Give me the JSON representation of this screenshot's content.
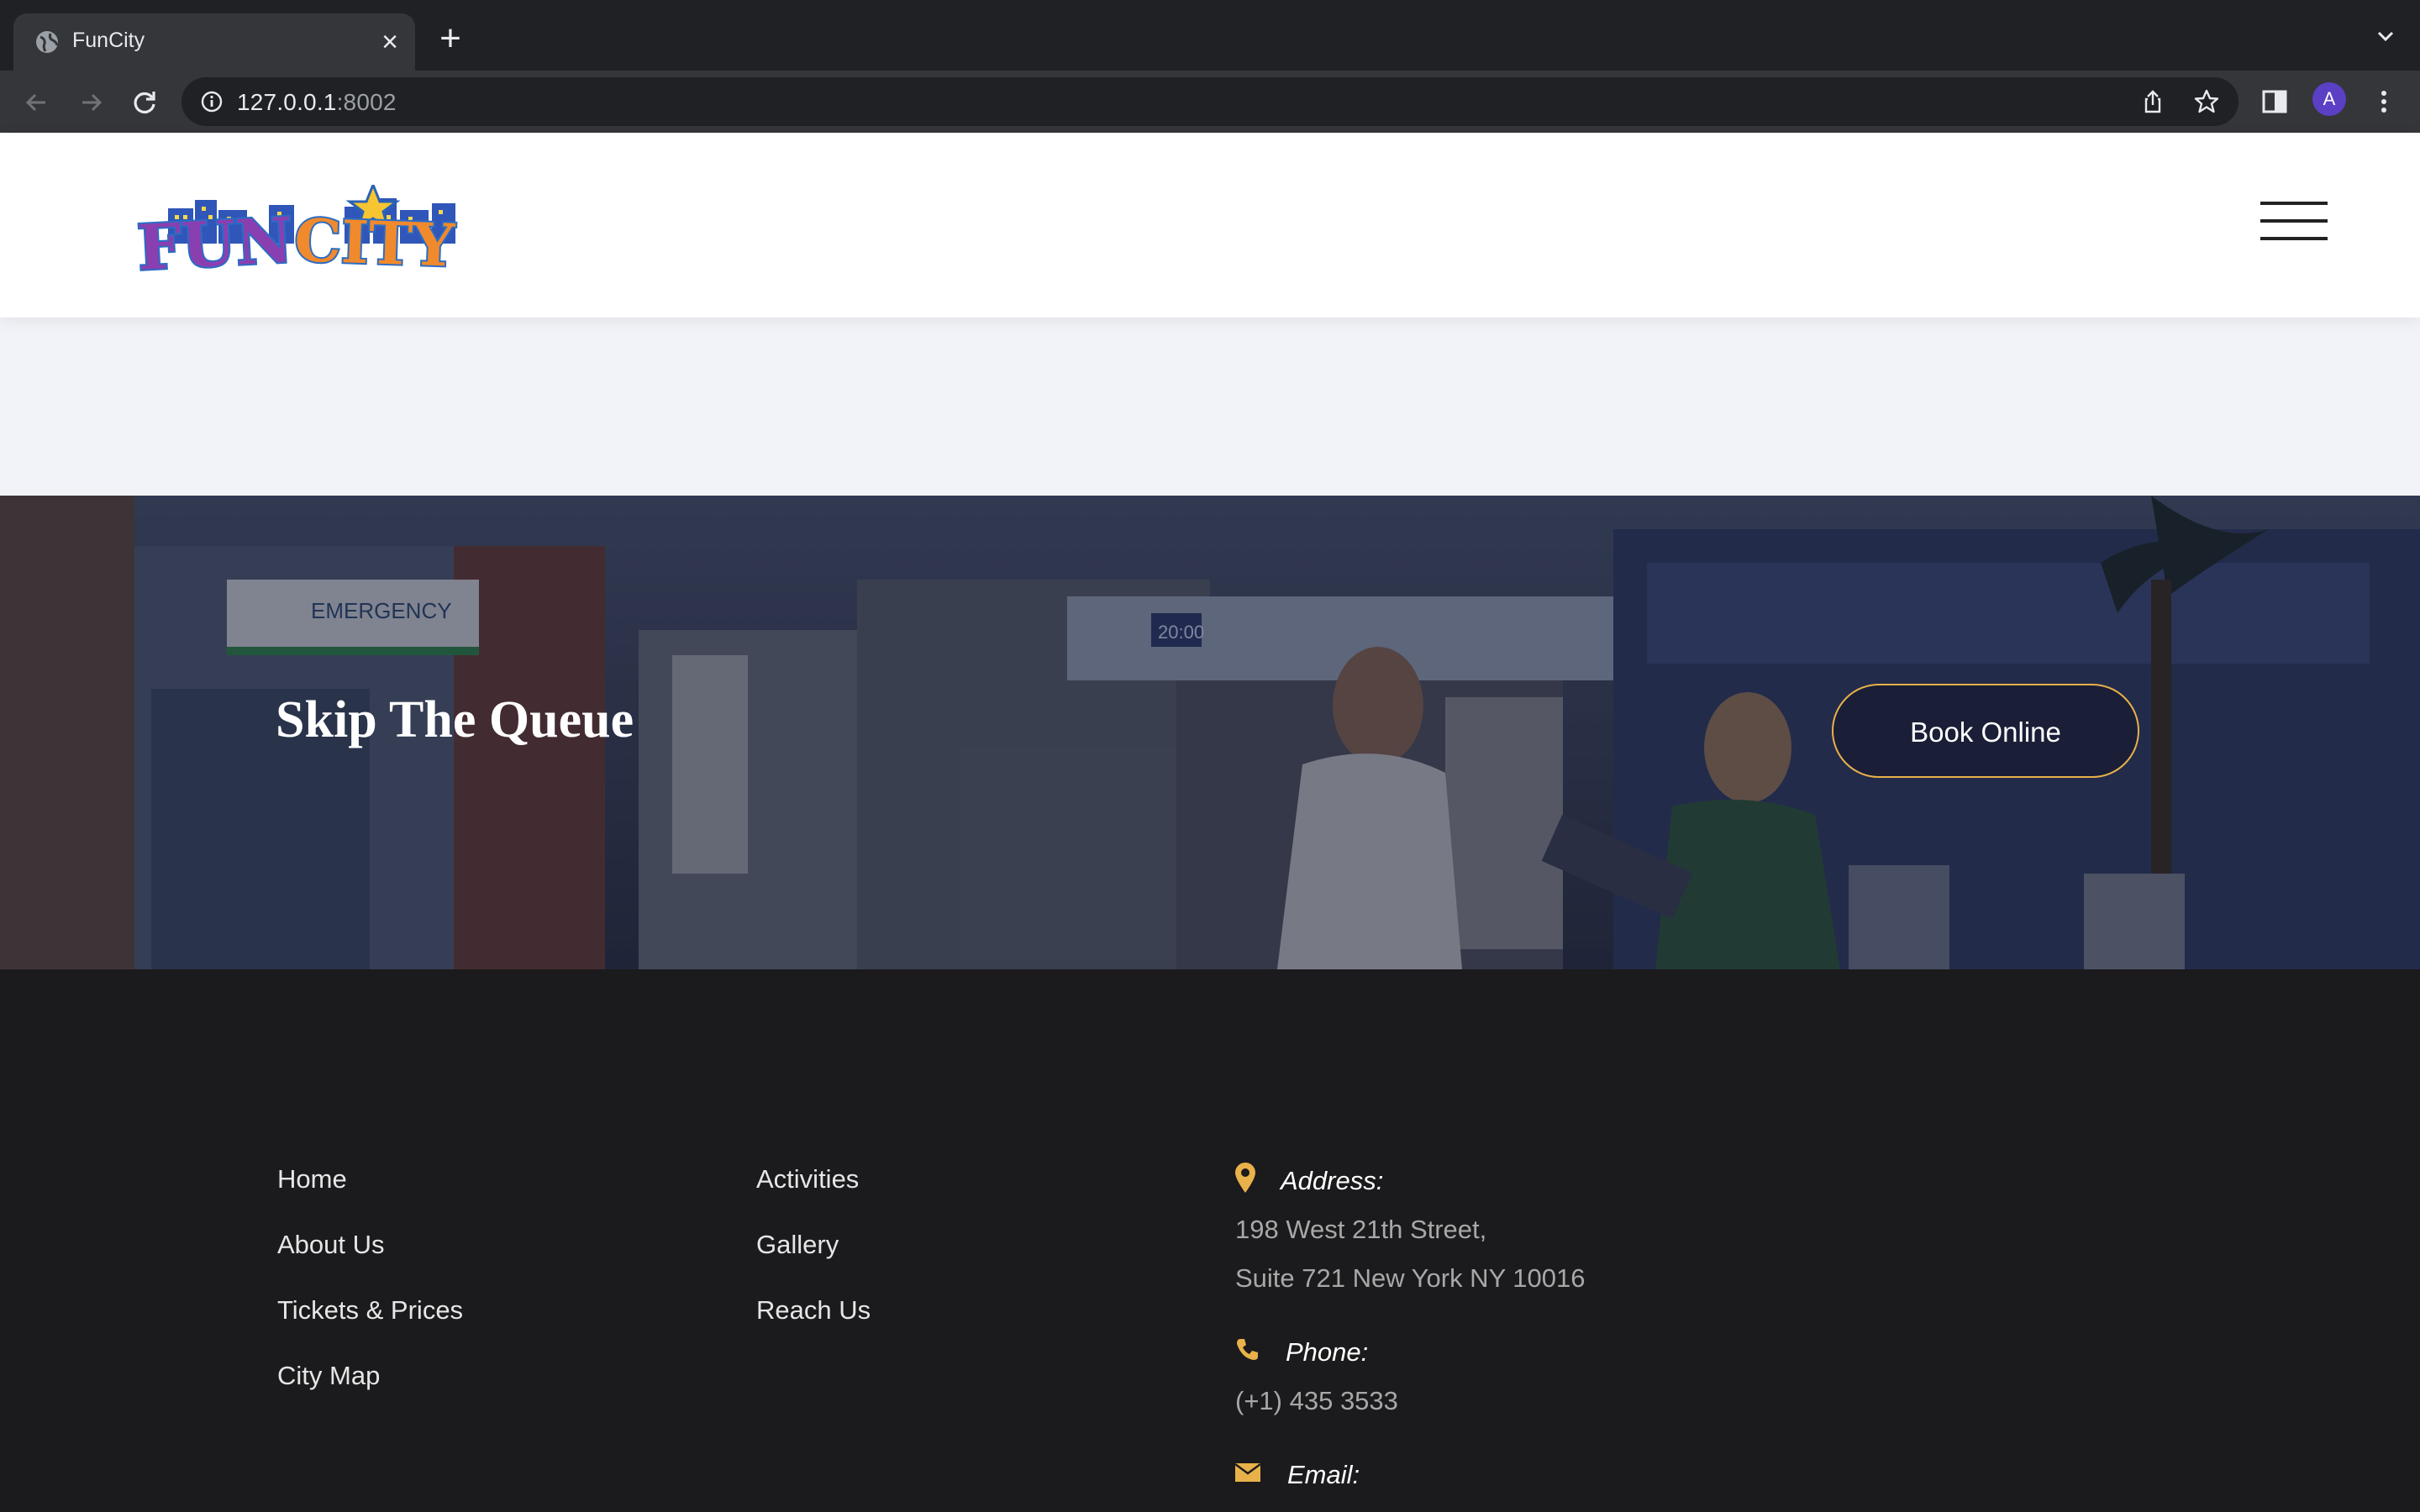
{
  "browser": {
    "tab_title": "FunCity",
    "url_host": "127.0.0.1",
    "url_port": ":8002",
    "profile_initial": "A"
  },
  "header": {
    "logo_text": "FUN CITY"
  },
  "hero": {
    "title": "Skip The Queue",
    "button_label": "Book Online",
    "scene_signs": [
      "EMERGENCY",
      "20:00"
    ]
  },
  "footer": {
    "col1": [
      "Home",
      "About Us",
      "Tickets & Prices",
      "City Map"
    ],
    "col2": [
      "Activities",
      "Gallery",
      "Reach Us"
    ],
    "address_label": "Address:",
    "address_line1": "198 West 21th Street,",
    "address_line2": "Suite 721 New York NY 10016",
    "phone_label": "Phone:",
    "phone_value": "(+1) 435 3533",
    "email_label": "Email:"
  },
  "colors": {
    "accent": "#e8b14a",
    "footer_bg": "#1b1a1c",
    "chrome_bg": "#202124"
  }
}
